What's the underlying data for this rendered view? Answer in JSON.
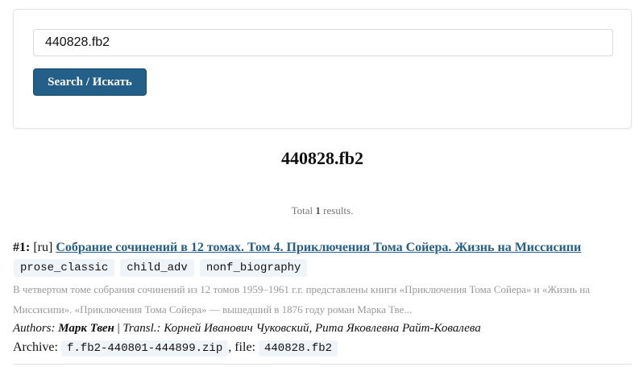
{
  "search": {
    "value": "440828.fb2",
    "button_label": "Search / Искать"
  },
  "page_title": "440828.fb2",
  "total": {
    "prefix": "Total",
    "count": "1",
    "suffix": "results."
  },
  "results": [
    {
      "number": "#1:",
      "lang": "[ru]",
      "title": "Собрание сочинений в 12 томах. Том 4. Приключения Тома Сойера. Жизнь на Миссисипи",
      "tags": [
        "prose_classic",
        "child_adv",
        "nonf_biography"
      ],
      "description": "В четвертом томе собрания сочинений из 12 томов 1959–1961 г.г. представлены книги «Приключения Тома Сойера» и «Жизнь на Миссисипи». «Приключения Тома Сойера» — вышедший в 1876 году роман Марка Тве...",
      "authors_label": "Authors:",
      "authors": "Марк Твен",
      "transl_sep": "|",
      "transl_label": "Transl.:",
      "translators": "Корней Иванович Чуковский, Рита Яковлевна Райт-Ковалева",
      "archive_label": "Archive:",
      "archive": "f.fb2-440801-444899.zip",
      "file_label": ", file:",
      "file": "440828.fb2"
    }
  ]
}
